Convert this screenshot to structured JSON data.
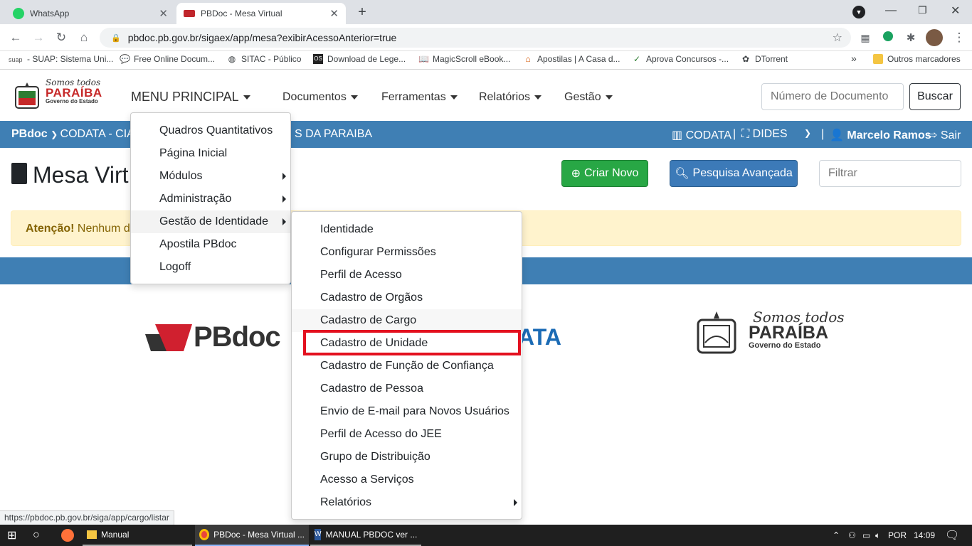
{
  "browser": {
    "tabs": [
      {
        "title": "WhatsApp",
        "active": false
      },
      {
        "title": "PBDoc - Mesa Virtual",
        "active": true
      }
    ],
    "url": "pbdoc.pb.gov.br/sigaex/app/mesa?exibirAcessoAnterior=true",
    "bookmarks": [
      "- SUAP: Sistema Uni...",
      "Free Online Docum...",
      "SITAC - Público",
      "Download de Lege...",
      "MagicScroll eBook...",
      "Apostilas | A Casa d...",
      "Aprova Concursos -...",
      "DTorrent"
    ],
    "bookmark_small": "suap",
    "other_bookmarks": "Outros marcadores",
    "status_url": "https://pbdoc.pb.gov.br/siga/app/cargo/listar"
  },
  "brand": {
    "line1": "Somos todos",
    "line2": "PARAÍBA",
    "line3": "Governo do Estado",
    "pbdoc": "PBdoc",
    "codata_partial": "ATA"
  },
  "nav": {
    "menu_principal": "MENU PRINCIPAL",
    "documentos": "Documentos",
    "ferramentas": "Ferramentas",
    "relatorios": "Relatórios",
    "gestao": "Gestão",
    "doc_placeholder": "Número de Documento",
    "buscar": "Buscar"
  },
  "bluebar": {
    "pbdoc": "PBdoc",
    "org_left": "CODATA - CIA",
    "org_right": "S DA PARAIBA",
    "unit1": "CODATA",
    "unit2": "DIDES",
    "user": "Marcelo Ramos",
    "sair": "Sair"
  },
  "main": {
    "title": "Mesa Virt",
    "criar_novo": "Criar Novo",
    "pesquisa": "Pesquisa Avançada",
    "filtrar_placeholder": "Filtrar",
    "alert_bold": "Atenção!",
    "alert_text": "Nenhum de"
  },
  "menu_principal_items": [
    "Quadros Quantitativos",
    "Página Inicial",
    "Módulos",
    "Administração",
    "Gestão de Identidade",
    "Apostila PBdoc",
    "Logoff"
  ],
  "gestao_identidade_items": [
    "Identidade",
    "Configurar Permissões",
    "Perfil de Acesso",
    "Cadastro de Orgãos",
    "Cadastro de Cargo",
    "Cadastro de Unidade",
    "Cadastro de Função de Confiança",
    "Cadastro de Pessoa",
    "Envio de E-mail para Novos Usuários",
    "Perfil de Acesso do JEE",
    "Grupo de Distribuição",
    "Acesso a Serviços",
    "Relatórios"
  ],
  "highlighted_item": "Cadastro de Unidade",
  "colors": {
    "blue_bar": "#3f7fb4",
    "success": "#28a745",
    "primary": "#3c7ab8",
    "highlight": "#e3101f",
    "alert_bg": "#fff3cd"
  },
  "taskbar": {
    "items": [
      "Manual",
      "PBDoc - Mesa Virtual ...",
      "MANUAL PBDOC ver ..."
    ],
    "lang": "POR",
    "time": "14:09"
  }
}
